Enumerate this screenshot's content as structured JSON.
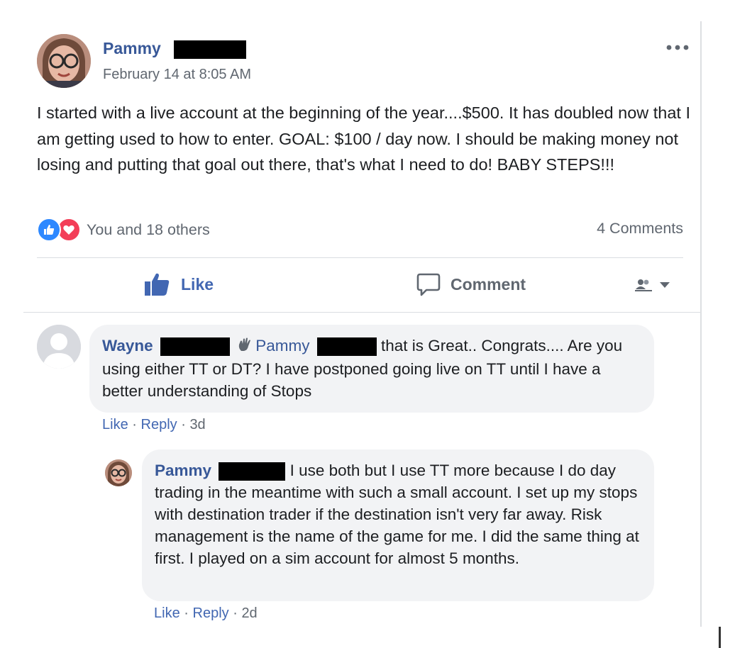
{
  "post": {
    "author_name": "Pammy",
    "timestamp": "February 14 at 8:05 AM",
    "text": "I started with a live account at the beginning of the year....$500. It has doubled now that I am getting used to how to enter. GOAL: $100 / day now. I should be making money not losing and putting that goal out there, that's what I need to do! BABY STEPS!!!",
    "reactions_text": "You and 18 others",
    "comments_count": "4 Comments",
    "icons": {
      "more": "more-options-icon",
      "like_reaction": "thumbs-up-icon",
      "love_reaction": "heart-icon",
      "like_action": "thumbs-up-icon",
      "comment_action": "speech-bubble-icon",
      "audience": "audience-selector-icon"
    },
    "colors": {
      "link_blue": "#385898",
      "action_blue": "#4267b2",
      "like_blue": "#2d88ff",
      "love_red": "#f33e58",
      "bubble_gray": "#f2f3f5",
      "meta_gray": "#606770"
    }
  },
  "actions": {
    "like_label": "Like",
    "comment_label": "Comment"
  },
  "comments": [
    {
      "author": "Wayne",
      "mention": "Pammy",
      "text": "that is Great.. Congrats.... Are you using either TT or DT? I have postponed going live on TT until I have a better understanding of Stops",
      "like_label": "Like",
      "reply_label": "Reply",
      "age": "3d",
      "sep": "·"
    },
    {
      "author": "Pammy",
      "text": "I use both but I use TT more because I do day trading in the meantime with such a small account. I set up my stops with destination trader if the destination isn't very far away. Risk management is the name of the game for me. I did the same thing at first. I played on a sim account for almost 5 months.",
      "like_label": "Like",
      "reply_label": "Reply",
      "age": "2d",
      "sep": "·"
    }
  ]
}
